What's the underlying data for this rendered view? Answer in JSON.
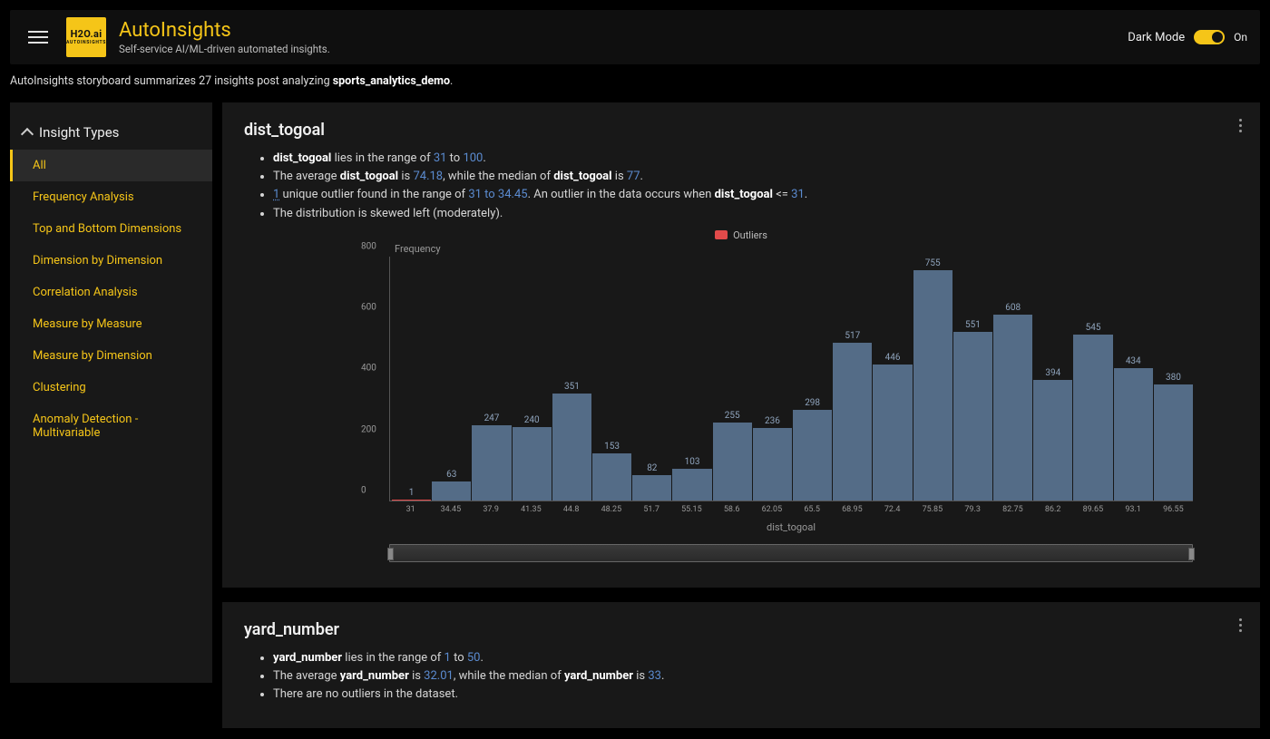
{
  "header": {
    "logo_text_1": "H2O.ai",
    "logo_text_2": "AUTOINSIGHTS",
    "title": "AutoInsights",
    "subtitle": "Self-service AI/ML-driven automated insights.",
    "dark_mode_label": "Dark Mode",
    "dark_mode_state": "On"
  },
  "summary_prefix": "AutoInsights storyboard summarizes 27 insights post analyzing ",
  "summary_dataset": "sports_analytics_demo",
  "sidebar": {
    "heading": "Insight Types",
    "items": [
      "All",
      "Frequency Analysis",
      "Top and Bottom Dimensions",
      "Dimension by Dimension",
      "Correlation Analysis",
      "Measure by Measure",
      "Measure by Dimension",
      "Clustering",
      "Anomaly Detection - Multivariable"
    ],
    "active_index": 0
  },
  "cards": {
    "dist_togoal": {
      "title": "dist_togoal",
      "bullets_html": [
        "<b>dist_togoal</b> lies in the range of <span class='num'>31</span> to <span class='num'>100</span>.",
        "The average <b>dist_togoal</b> is <span class='num'>74.18</span>, while the median of <b>dist_togoal</b> is <span class='num'>77</span>.",
        "<span class='num under'>1</span> unique outlier found in the range of <span class='num'>31 to 34.45</span>. An outlier in the data occurs when <b>dist_togoal</b> <= <span class='num'>31</span>.",
        "The distribution is skewed left (moderately)."
      ],
      "legend": "Outliers",
      "chart": {
        "ylabel": "Frequency",
        "xlabel": "dist_togoal"
      }
    },
    "yard_number": {
      "title": "yard_number",
      "bullets_html": [
        "<b>yard_number</b> lies in the range of <span class='num'>1</span> to <span class='num'>50</span>.",
        "The average <b>yard_number</b> is <span class='num'>32.01</span>, while the median of <b>yard_number</b> is <span class='num'>33</span>.",
        "There are no outliers in the dataset."
      ]
    }
  },
  "chart_data": {
    "type": "bar",
    "title": "",
    "xlabel": "dist_togoal",
    "ylabel": "Frequency",
    "ylim": [
      0,
      800
    ],
    "yticks": [
      0,
      200,
      400,
      600,
      800
    ],
    "categories": [
      "31",
      "34.45",
      "37.9",
      "41.35",
      "44.8",
      "48.25",
      "51.7",
      "55.15",
      "58.6",
      "62.05",
      "65.5",
      "68.95",
      "72.4",
      "75.85",
      "79.3",
      "82.75",
      "86.2",
      "89.65",
      "93.1",
      "96.55"
    ],
    "values": [
      1,
      63,
      247,
      240,
      351,
      153,
      82,
      103,
      255,
      236,
      298,
      517,
      446,
      755,
      551,
      608,
      394,
      545,
      434,
      380
    ],
    "outlier_flags": [
      true,
      false,
      false,
      false,
      false,
      false,
      false,
      false,
      false,
      false,
      false,
      false,
      false,
      false,
      false,
      false,
      false,
      false,
      false,
      false
    ],
    "legend": "Outliers"
  }
}
